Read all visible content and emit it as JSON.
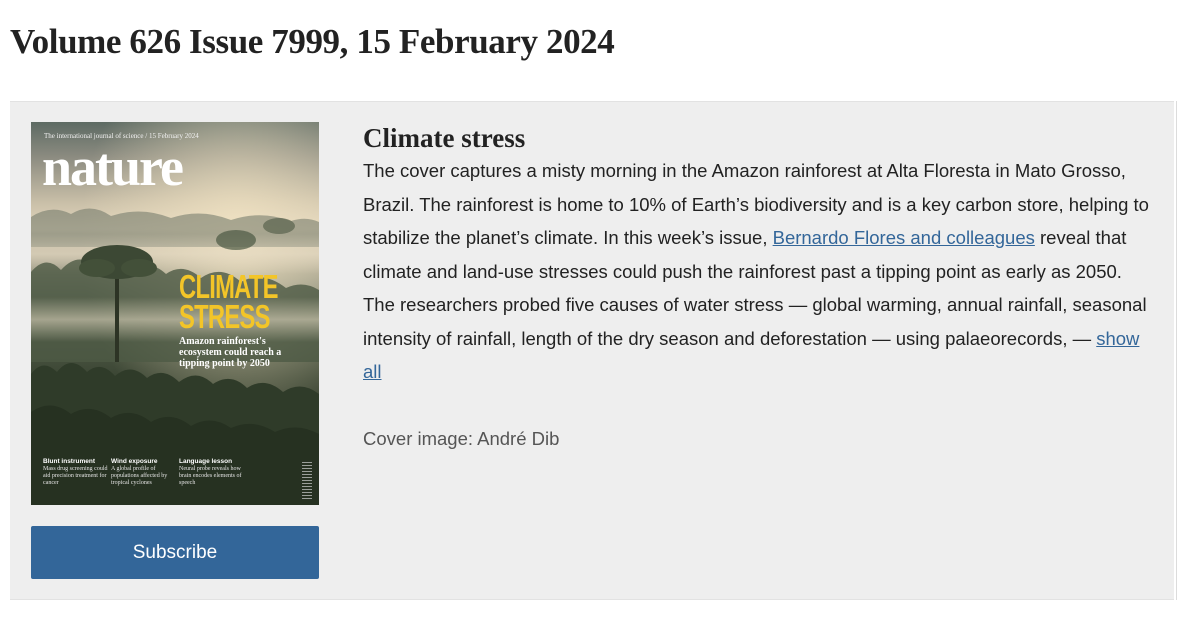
{
  "page": {
    "title": "Volume 626 Issue 7999, 15 February 2024"
  },
  "cover": {
    "journal_tagline": "The international journal of science / 15 February 2024",
    "masthead": "nature",
    "headline_line1": "CLIMATE",
    "headline_line2": "STRESS",
    "subline": "Amazon rainforest's ecosystem could reach a tipping point by 2050",
    "teasers": [
      {
        "title": "Blunt instrument",
        "text": "Mass drug screening could aid precision treatment for cancer"
      },
      {
        "title": "Wind exposure",
        "text": "A global profile of populations affected by tropical cyclones"
      },
      {
        "title": "Language lesson",
        "text": "Neural probe reveals how brain encodes elements of speech"
      }
    ]
  },
  "subscribe": {
    "label": "Subscribe"
  },
  "story": {
    "title": "Climate stress",
    "text_part1": "The cover captures a misty morning in the Amazon rainforest at Alta Floresta in Mato Grosso, Brazil. The rainforest is home to 10% of Earth’s biodiversity and is a key carbon store, helping to stabilize the planet’s climate. In this week’s issue, ",
    "link_authors": "Bernardo Flores and colleagues",
    "text_part2": " reveal that climate and land-use stresses could push the rainforest past a tipping point as early as 2050. The researchers probed five causes of water stress — global warming, annual rainfall, seasonal intensity of rainfall, length of the dry season and deforestation — using palaeorecords, — ",
    "show_all": "show all",
    "credit": "Cover image: André Dib"
  },
  "colors": {
    "link": "#336699",
    "subscribe_button": "#336699",
    "panel_background": "#eeeeee",
    "cover_headline": "#f3c528"
  }
}
